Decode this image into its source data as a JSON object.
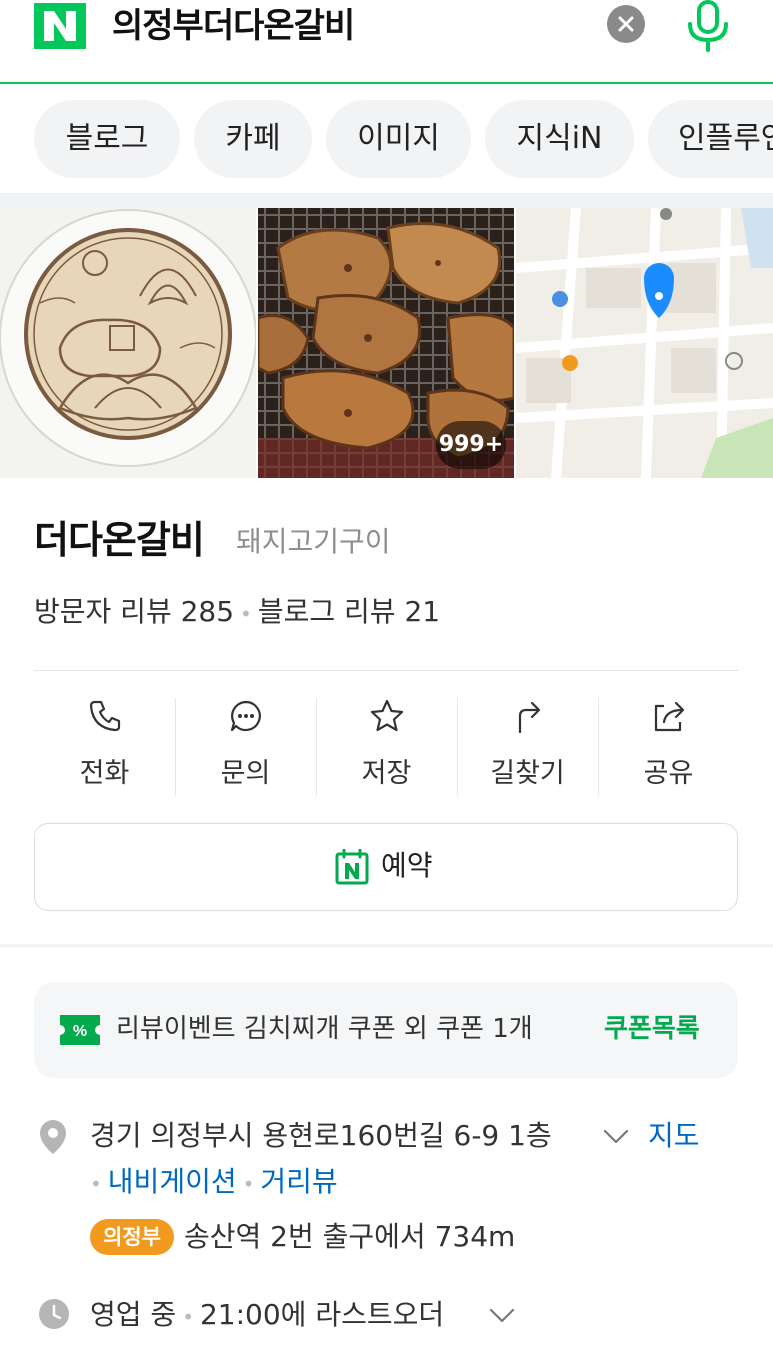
{
  "search": {
    "query": "의정부더다온갈비",
    "brand_color": "#03c75a",
    "clear_icon": "close-icon",
    "mic_icon": "mic-icon"
  },
  "tabs": [
    {
      "label": "블로그"
    },
    {
      "label": "카페"
    },
    {
      "label": "이미지"
    },
    {
      "label": "지식iN"
    },
    {
      "label": "인플루언"
    }
  ],
  "photos": {
    "count_badge": "999+"
  },
  "place": {
    "name": "더다온갈비",
    "category": "돼지고기구이",
    "visitor_reviews": "방문자 리뷰 285",
    "blog_reviews": "블로그 리뷰 21"
  },
  "actions": [
    {
      "label": "전화",
      "icon": "phone-icon"
    },
    {
      "label": "문의",
      "icon": "chat-icon"
    },
    {
      "label": "저장",
      "icon": "star-icon"
    },
    {
      "label": "길찾기",
      "icon": "directions-icon"
    },
    {
      "label": "공유",
      "icon": "share-icon"
    }
  ],
  "reserve": {
    "label": "예약",
    "icon": "naver-calendar-icon"
  },
  "coupon": {
    "text": "리뷰이벤트 김치찌개 쿠폰 외 쿠폰 1개",
    "link": "쿠폰목록",
    "icon": "coupon-icon"
  },
  "address": {
    "text": "경기 의정부시 용현로160번길 6-9 1층",
    "map_link": "지도",
    "navigation_link": "내비게이션",
    "street_view_link": "거리뷰",
    "station_badge": "의정부",
    "station_text": "송산역 2번 출구에서 734m"
  },
  "hours": {
    "status": "영업 중",
    "last_order": "21:00에 라스트오더"
  },
  "colors": {
    "link_blue": "#0068c3",
    "badge_orange": "#f29a1f",
    "accent_green": "#03a94d"
  }
}
